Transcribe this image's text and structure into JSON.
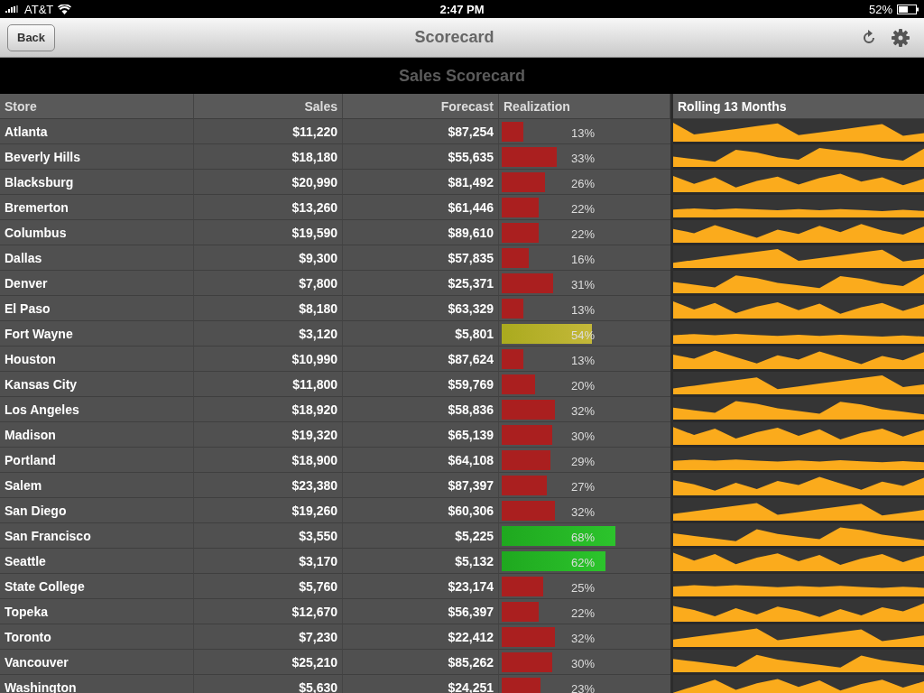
{
  "status_bar": {
    "carrier": "AT&T",
    "time": "2:47 PM",
    "battery": "52%"
  },
  "nav_bar": {
    "back": "Back",
    "title": "Scorecard"
  },
  "report_title": "Sales Scorecard",
  "table": {
    "columns": [
      "Store",
      "Sales",
      "Forecast",
      "Realization",
      "Rolling 13 Months"
    ],
    "rows": [
      {
        "store": "Atlanta",
        "sales": "$11,220",
        "forecast": "$87,254",
        "realization": "13%",
        "level": 0.13
      },
      {
        "store": "Beverly Hills",
        "sales": "$18,180",
        "forecast": "$55,635",
        "realization": "33%",
        "level": 0.33
      },
      {
        "store": "Blacksburg",
        "sales": "$20,990",
        "forecast": "$81,492",
        "realization": "26%",
        "level": 0.26
      },
      {
        "store": "Bremerton",
        "sales": "$13,260",
        "forecast": "$61,446",
        "realization": "22%",
        "level": 0.22
      },
      {
        "store": "Columbus",
        "sales": "$19,590",
        "forecast": "$89,610",
        "realization": "22%",
        "level": 0.22
      },
      {
        "store": "Dallas",
        "sales": "$9,300",
        "forecast": "$57,835",
        "realization": "16%",
        "level": 0.16
      },
      {
        "store": "Denver",
        "sales": "$7,800",
        "forecast": "$25,371",
        "realization": "31%",
        "level": 0.31
      },
      {
        "store": "El Paso",
        "sales": "$8,180",
        "forecast": "$63,329",
        "realization": "13%",
        "level": 0.13
      },
      {
        "store": "Fort Wayne",
        "sales": "$3,120",
        "forecast": "$5,801",
        "realization": "54%",
        "level": 0.54
      },
      {
        "store": "Houston",
        "sales": "$10,990",
        "forecast": "$87,624",
        "realization": "13%",
        "level": 0.13
      },
      {
        "store": "Kansas City",
        "sales": "$11,800",
        "forecast": "$59,769",
        "realization": "20%",
        "level": 0.2
      },
      {
        "store": "Los Angeles",
        "sales": "$18,920",
        "forecast": "$58,836",
        "realization": "32%",
        "level": 0.32
      },
      {
        "store": "Madison",
        "sales": "$19,320",
        "forecast": "$65,139",
        "realization": "30%",
        "level": 0.3
      },
      {
        "store": "Portland",
        "sales": "$18,900",
        "forecast": "$64,108",
        "realization": "29%",
        "level": 0.29
      },
      {
        "store": "Salem",
        "sales": "$23,380",
        "forecast": "$87,397",
        "realization": "27%",
        "level": 0.27
      },
      {
        "store": "San Diego",
        "sales": "$19,260",
        "forecast": "$60,306",
        "realization": "32%",
        "level": 0.32
      },
      {
        "store": "San Francisco",
        "sales": "$3,550",
        "forecast": "$5,225",
        "realization": "68%",
        "level": 0.68
      },
      {
        "store": "Seattle",
        "sales": "$3,170",
        "forecast": "$5,132",
        "realization": "62%",
        "level": 0.62
      },
      {
        "store": "State College",
        "sales": "$5,760",
        "forecast": "$23,174",
        "realization": "25%",
        "level": 0.25
      },
      {
        "store": "Topeka",
        "sales": "$12,670",
        "forecast": "$56,397",
        "realization": "22%",
        "level": 0.22
      },
      {
        "store": "Toronto",
        "sales": "$7,230",
        "forecast": "$22,412",
        "realization": "32%",
        "level": 0.32
      },
      {
        "store": "Vancouver",
        "sales": "$25,210",
        "forecast": "$85,262",
        "realization": "30%",
        "level": 0.3
      },
      {
        "store": "Washington",
        "sales": "$5,630",
        "forecast": "$24,251",
        "realization": "23%",
        "level": 0.23
      }
    ]
  }
}
